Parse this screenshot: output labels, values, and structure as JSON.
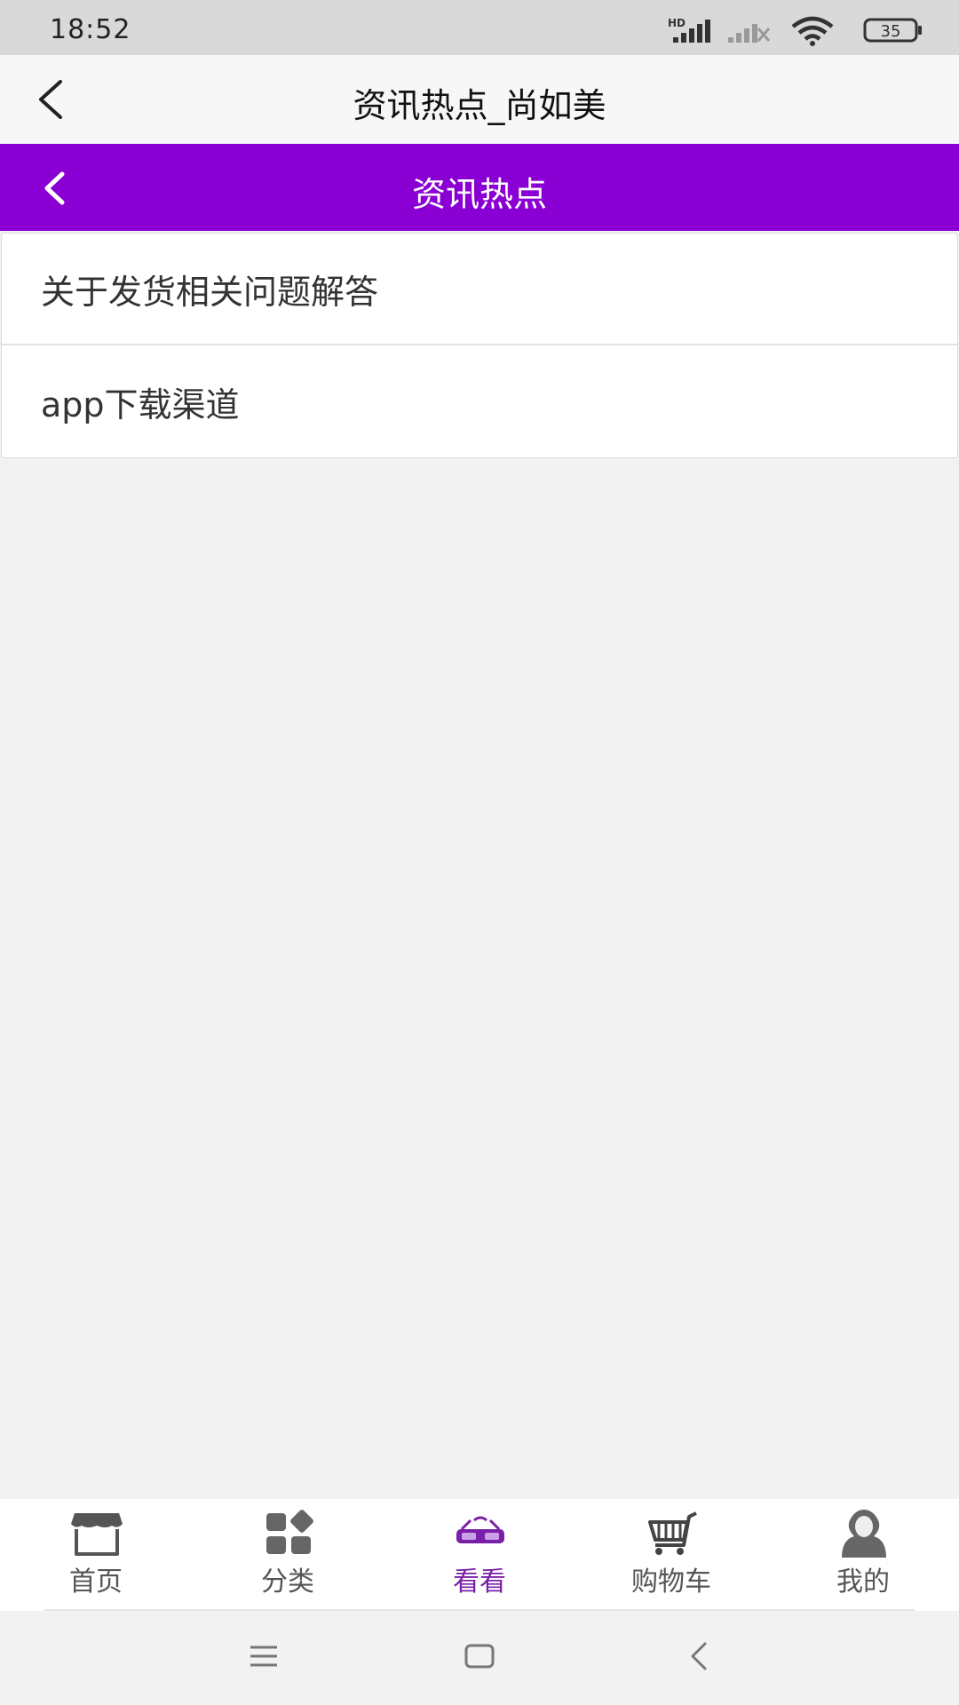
{
  "status_bar": {
    "time": "18:52",
    "hd_label": "HD",
    "battery": "35"
  },
  "title_bar": {
    "title": "资讯热点_尚如美"
  },
  "header": {
    "title": "资讯热点"
  },
  "list": {
    "items": [
      {
        "label": "关于发货相关问题解答"
      },
      {
        "label": "app下载渠道"
      }
    ]
  },
  "bottom_nav": {
    "items": [
      {
        "label": "首页",
        "icon": "shop-icon",
        "active": false
      },
      {
        "label": "分类",
        "icon": "category-icon",
        "active": false
      },
      {
        "label": "看看",
        "icon": "glasses-icon",
        "active": true
      },
      {
        "label": "购物车",
        "icon": "cart-icon",
        "active": false
      },
      {
        "label": "我的",
        "icon": "profile-icon",
        "active": false
      }
    ]
  },
  "colors": {
    "accent": "#8a00d4",
    "active_nav": "#7a1fa8"
  }
}
